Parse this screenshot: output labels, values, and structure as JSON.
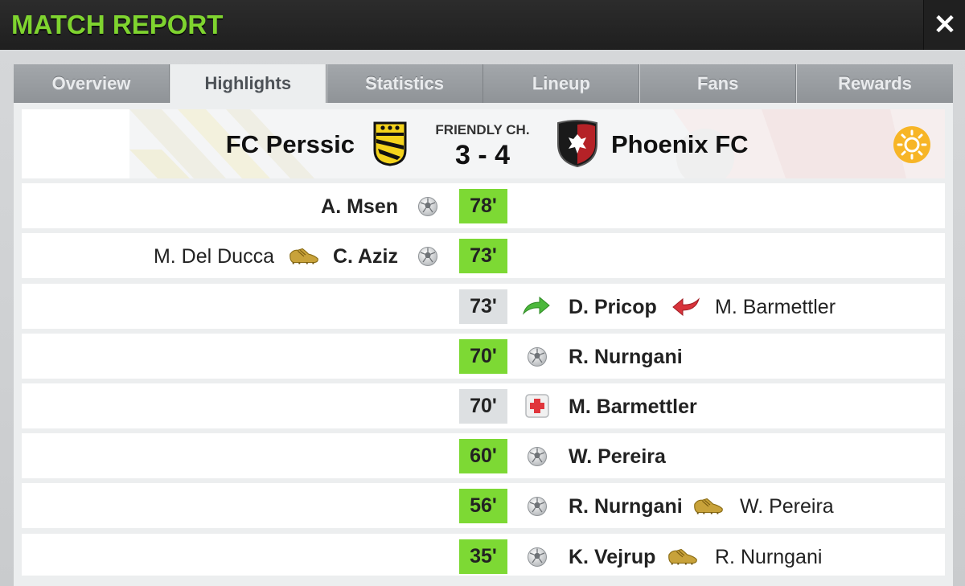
{
  "header": {
    "title": "MATCH REPORT",
    "close_symbol": "✕"
  },
  "tabs": [
    {
      "label": "Overview"
    },
    {
      "label": "Highlights",
      "active": true
    },
    {
      "label": "Statistics"
    },
    {
      "label": "Lineup"
    },
    {
      "label": "Fans"
    },
    {
      "label": "Rewards"
    }
  ],
  "match": {
    "home_team": "FC Perssic",
    "away_team": "Phoenix FC",
    "competition": "FRIENDLY CH.",
    "score": "3 - 4",
    "weather_icon": "sun-icon"
  },
  "events": [
    {
      "minute": "78'",
      "highlight": "green",
      "side": "home",
      "type": "goal",
      "player": "A. Msen",
      "assist": null
    },
    {
      "minute": "73'",
      "highlight": "green",
      "side": "home",
      "type": "goal",
      "player": "C. Aziz",
      "assist": "M. Del Ducca"
    },
    {
      "minute": "73'",
      "highlight": "grey",
      "side": "away",
      "type": "substitution",
      "player": "D. Pricop",
      "player_out": "M. Barmettler"
    },
    {
      "minute": "70'",
      "highlight": "green",
      "side": "away",
      "type": "goal",
      "player": "R. Nurngani",
      "assist": null
    },
    {
      "minute": "70'",
      "highlight": "grey",
      "side": "away",
      "type": "injury",
      "player": "M. Barmettler"
    },
    {
      "minute": "60'",
      "highlight": "green",
      "side": "away",
      "type": "goal",
      "player": "W. Pereira",
      "assist": null
    },
    {
      "minute": "56'",
      "highlight": "green",
      "side": "away",
      "type": "goal",
      "player": "R. Nurngani",
      "assist": "W. Pereira"
    },
    {
      "minute": "35'",
      "highlight": "green",
      "side": "away",
      "type": "goal",
      "player": "K. Vejrup",
      "assist": "R. Nurngani"
    }
  ],
  "colors": {
    "accent_green": "#7fd42f",
    "minute_green": "#7dd934",
    "minute_grey": "#dde0e2"
  }
}
